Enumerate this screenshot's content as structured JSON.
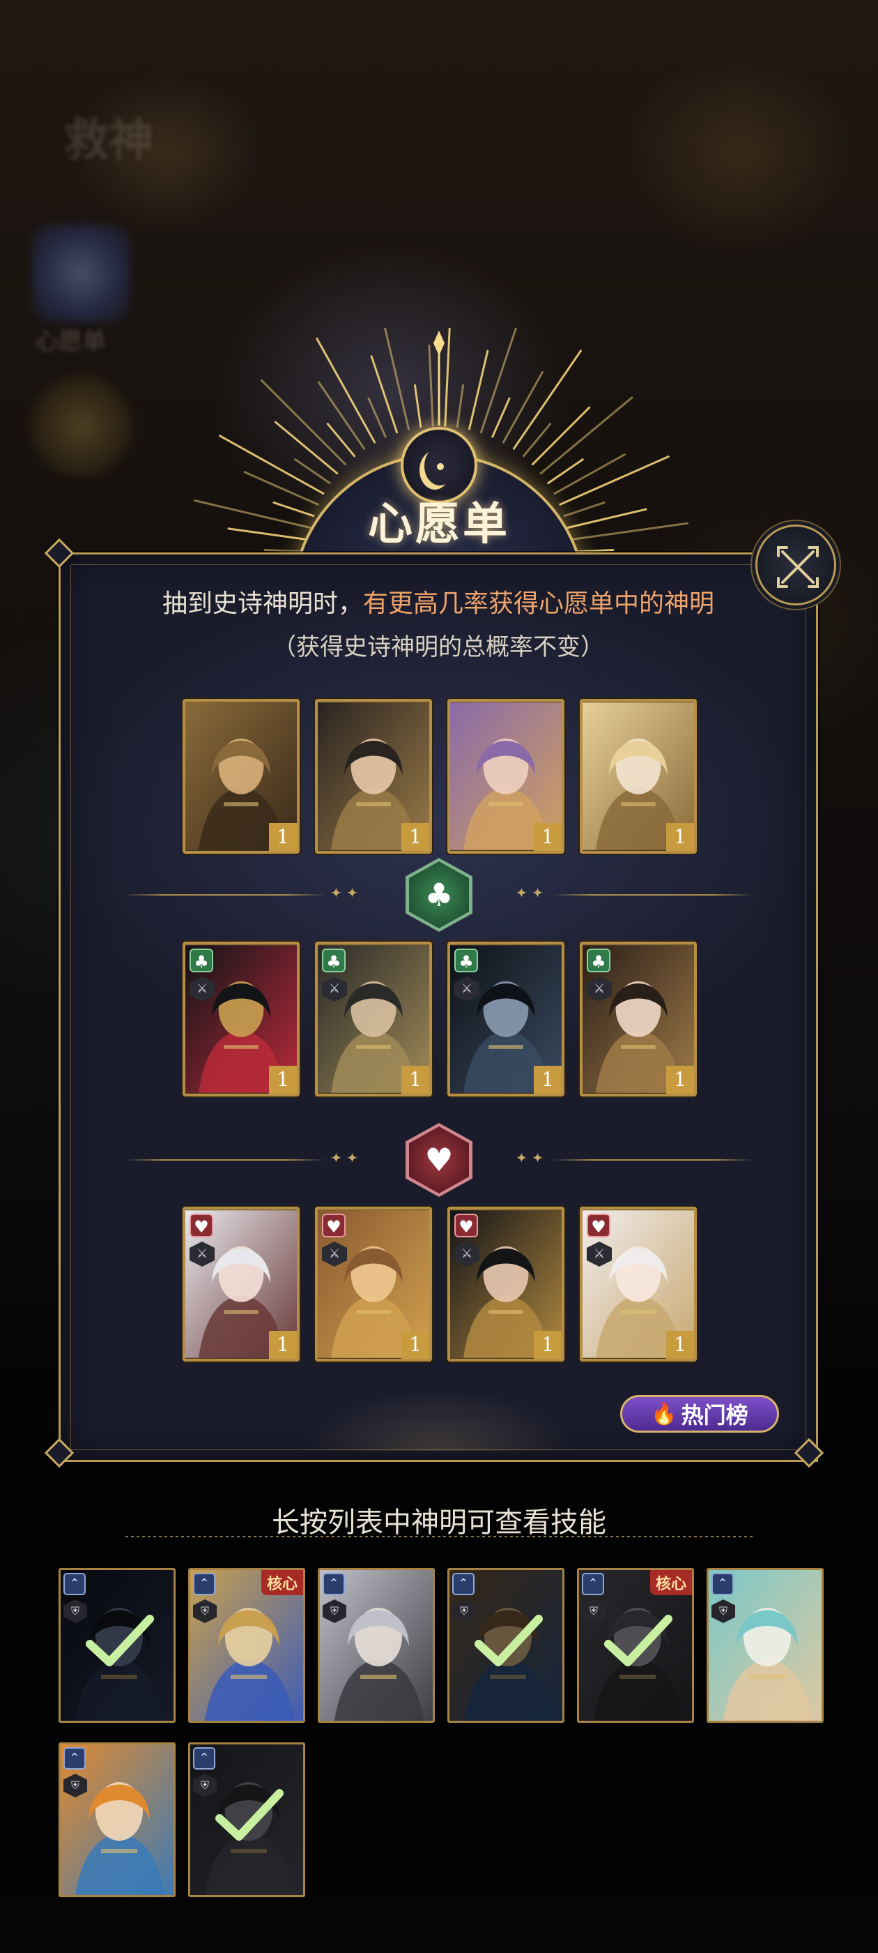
{
  "title": "心愿单",
  "description": {
    "prefix": "抽到史诗神明时，",
    "highlight": "有更高几率获得心愿单中的神明",
    "note": "（获得史诗神明的总概率不变）"
  },
  "hot_button": {
    "label": "热门榜"
  },
  "hint": "长按列表中神明可查看技能",
  "wishlist": {
    "rows": [
      {
        "suit": null,
        "cards": [
          {
            "count": "1",
            "palette": "gold-dark"
          },
          {
            "count": "1",
            "palette": "dark-gold"
          },
          {
            "count": "1",
            "palette": "purple"
          },
          {
            "count": "1",
            "palette": "blonde"
          }
        ]
      },
      {
        "suit": "club",
        "cards": [
          {
            "count": "1",
            "palette": "anubis"
          },
          {
            "count": "1",
            "palette": "horned"
          },
          {
            "count": "1",
            "palette": "raven"
          },
          {
            "count": "1",
            "palette": "empress"
          }
        ]
      },
      {
        "suit": "heart",
        "cards": [
          {
            "count": "1",
            "palette": "white-hair"
          },
          {
            "count": "1",
            "palette": "laughing"
          },
          {
            "count": "1",
            "palette": "hooded"
          },
          {
            "count": "1",
            "palette": "white-crown"
          }
        ]
      }
    ]
  },
  "roster": {
    "core_label": "核心",
    "cards": [
      {
        "name": "dark-knight",
        "selected": true,
        "core": false
      },
      {
        "name": "blue-demon",
        "selected": false,
        "core": true
      },
      {
        "name": "silver-queen",
        "selected": false,
        "core": false
      },
      {
        "name": "bearded-king",
        "selected": true,
        "core": false
      },
      {
        "name": "grey-elder",
        "selected": true,
        "core": true
      },
      {
        "name": "teal-elf",
        "selected": false,
        "core": false
      },
      {
        "name": "orange-boy",
        "selected": false,
        "core": false
      },
      {
        "name": "masked-duo",
        "selected": true,
        "core": false
      }
    ]
  },
  "colors": {
    "gold": "#b89a55",
    "highlight": "#f0a46a",
    "panel": "#1a1c2c",
    "club": "#2f7a48",
    "heart": "#8a2a32",
    "hot_button": "#6a3fb0"
  },
  "icons": {
    "close": "close-crossed-arrows-icon",
    "club": "club-suit-icon",
    "heart": "heart-suit-icon",
    "fire": "flame-icon",
    "check": "checkmark-icon"
  }
}
